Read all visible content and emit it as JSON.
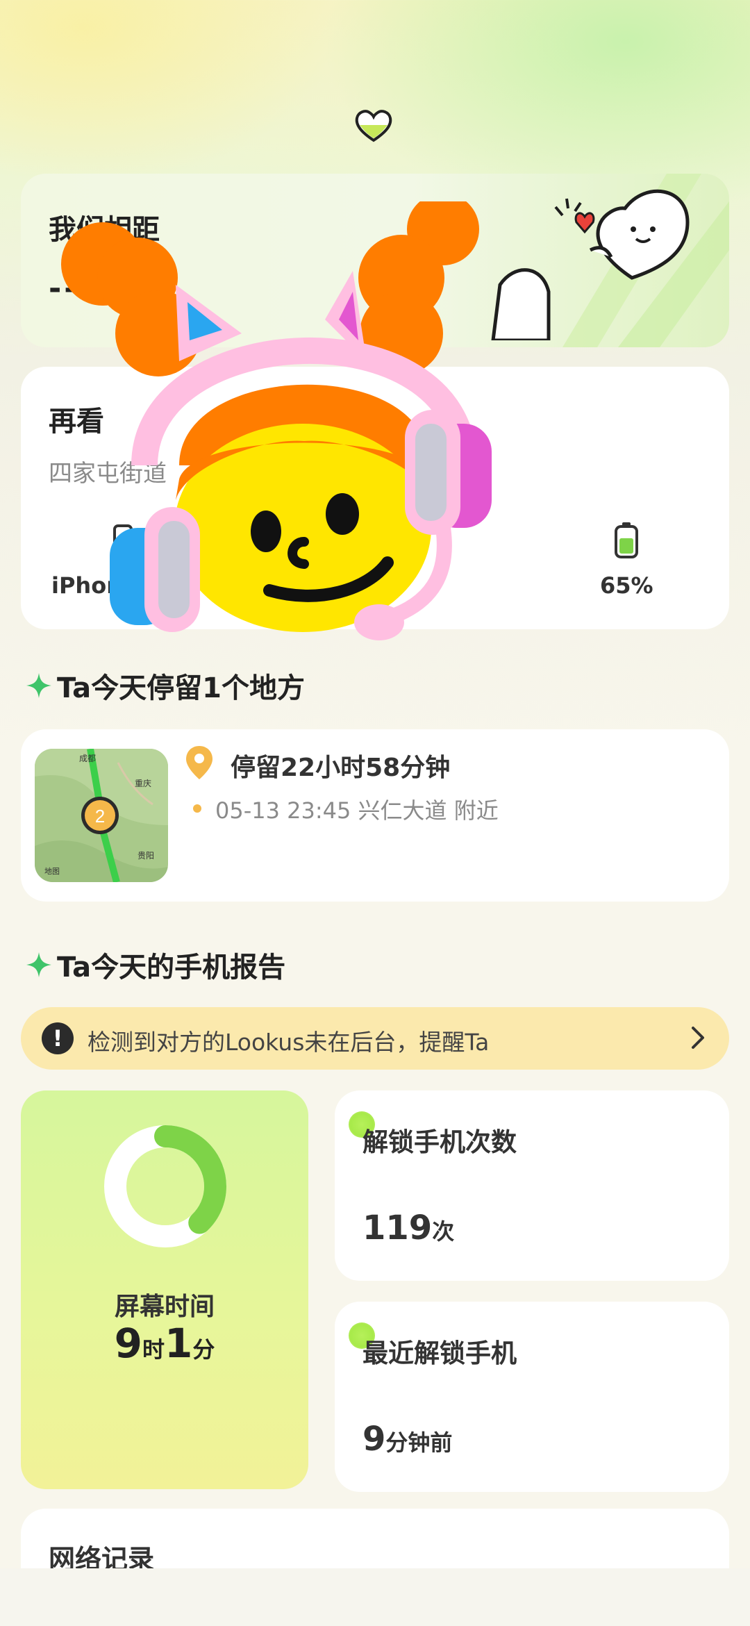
{
  "distance": {
    "title": "我们相距",
    "value": "--"
  },
  "device": {
    "title": "再看",
    "address": "四家屯街道",
    "phone_model": "iPhone",
    "battery": "65%",
    "battery_level": 0.65
  },
  "stay_section": {
    "heading": "Ta今天停留1个地方",
    "duration": "停留22小时58分钟",
    "detail": "05-13 23:45   兴仁大道 附近",
    "map_labels": {
      "city1": "成都",
      "city2": "重庆",
      "city3": "贵阳",
      "brand": "地图"
    },
    "cluster_count": "2"
  },
  "report_section": {
    "heading": "Ta今天的手机报告",
    "alert": {
      "icon": "!",
      "text": "检测到对方的Lookus未在后台，提醒Ta"
    }
  },
  "screen_time": {
    "label": "屏幕时间",
    "hours": "9",
    "hours_unit": "时",
    "minutes": "1",
    "minutes_unit": "分",
    "ring_fraction": 0.38
  },
  "unlock_count": {
    "title": "解锁手机次数",
    "value": "119",
    "unit": "次"
  },
  "recent_unlock": {
    "title": "最近解锁手机",
    "value": "9",
    "unit": "分钟前"
  },
  "network": {
    "title": "网络记录"
  },
  "colors": {
    "accent_green": "#7ed348",
    "pin_orange": "#f5b84a",
    "alert_bg": "#fbe9ad"
  }
}
